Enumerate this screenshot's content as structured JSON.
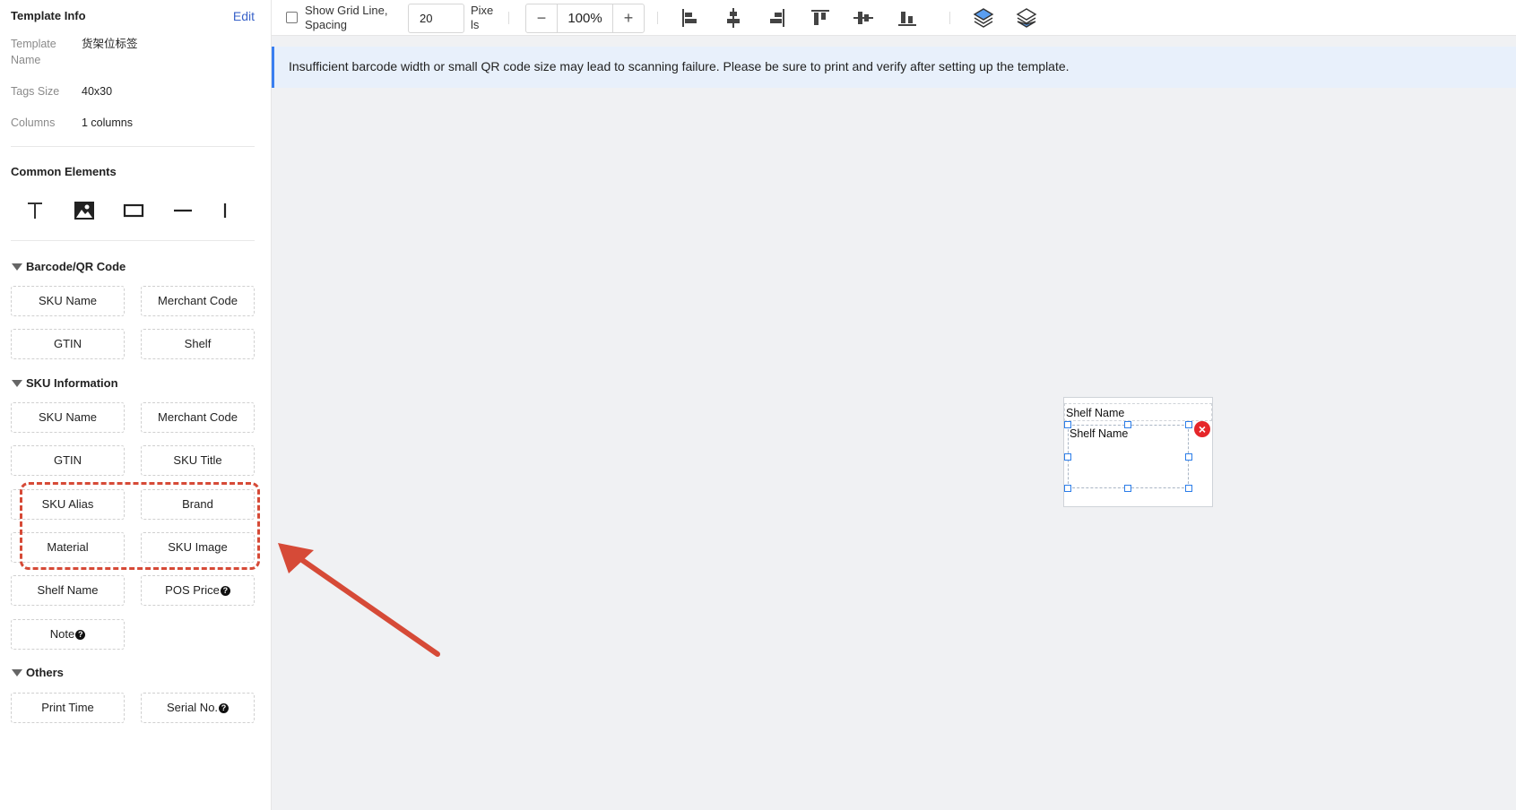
{
  "template_info": {
    "title": "Template Info",
    "edit_label": "Edit",
    "name_label": "Template Name",
    "name_value": "货架位标签",
    "size_label": "Tags Size",
    "size_value": "40x30",
    "columns_label": "Columns",
    "columns_value": "1 columns"
  },
  "common_elements": {
    "title": "Common Elements",
    "tools": [
      "text-icon",
      "image-icon",
      "rectangle-icon",
      "horizontal-line-icon",
      "vertical-line-icon"
    ]
  },
  "barcode_section": {
    "title": "Barcode/QR Code",
    "items": [
      "SKU Name",
      "Merchant Code",
      "GTIN",
      "Shelf"
    ]
  },
  "sku_section": {
    "title": "SKU Information",
    "items": [
      "SKU Name",
      "Merchant Code",
      "GTIN",
      "SKU Title",
      "SKU Alias",
      "Brand",
      "Material",
      "SKU Image",
      "Shelf Name",
      "POS Price",
      "Note"
    ]
  },
  "others_section": {
    "title": "Others",
    "items": [
      "Print Time",
      "Serial No."
    ]
  },
  "help_mark": "?",
  "toolbar": {
    "grid_label": "Show Grid Line, Spacing",
    "spacing_value": "20",
    "pixels_label": "Pixe ls",
    "zoom_minus": "−",
    "zoom_value": "100%",
    "zoom_plus": "+",
    "icons": [
      "align-left-icon",
      "align-center-horizontal-icon",
      "align-right-icon",
      "align-top-icon",
      "align-middle-vertical-icon",
      "align-bottom-icon",
      "layer-up-icon",
      "layer-down-icon"
    ]
  },
  "banner": {
    "message": "Insufficient barcode width or small QR code size may lead to scanning failure. Please be sure to print and verify after setting up the template."
  },
  "canvas": {
    "field1_text": "Shelf Name",
    "field2_text": "Shelf Name",
    "delete_symbol": "×"
  },
  "colors": {
    "accent": "#3a63c9",
    "annotation": "#d64a37",
    "banner_bg": "#e8f0fb",
    "handle": "#2b7de9",
    "delete": "#e5262a"
  }
}
